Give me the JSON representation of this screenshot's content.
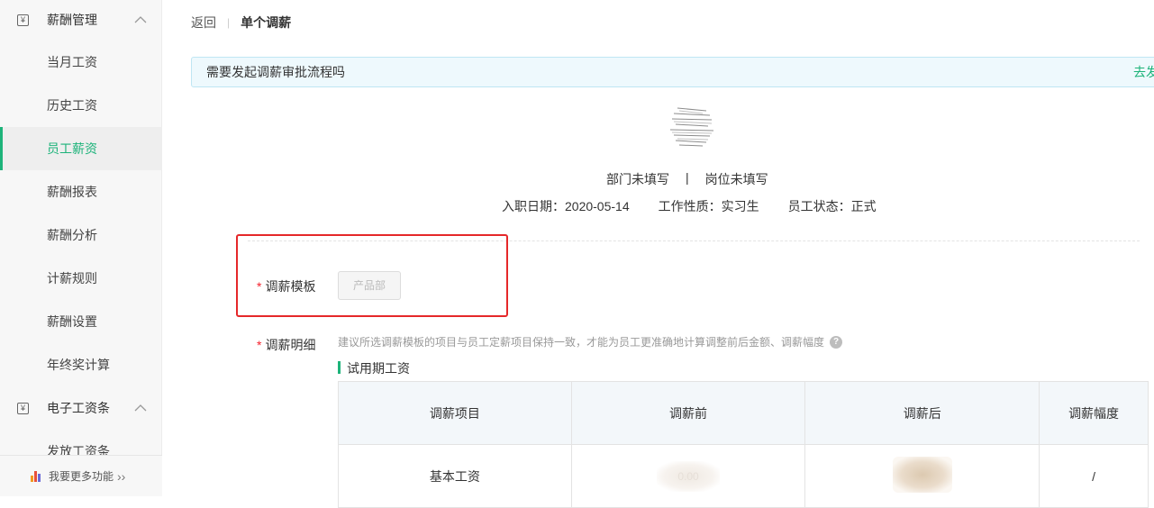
{
  "sidebar": {
    "group1": {
      "label": "薪酬管理",
      "icon": "salary-icon"
    },
    "items": [
      {
        "label": "当月工资"
      },
      {
        "label": "历史工资"
      },
      {
        "label": "员工薪资",
        "active": true
      },
      {
        "label": "薪酬报表"
      },
      {
        "label": "薪酬分析"
      },
      {
        "label": "计薪规则"
      },
      {
        "label": "薪酬设置"
      },
      {
        "label": "年终奖计算"
      }
    ],
    "group2": {
      "label": "电子工资条",
      "icon": "payslip-icon"
    },
    "partial_item": {
      "label": "发放工资条"
    },
    "more": {
      "label": "我要更多功能",
      "icon": "bar-chart-icon"
    }
  },
  "breadcrumb": {
    "back": "返回",
    "current": "单个调薪"
  },
  "notice": {
    "text": "需要发起调薪审批流程吗",
    "action": "去发"
  },
  "employee": {
    "department": "部门未填写",
    "position": "岗位未填写",
    "hire_date": "入职日期：2020-05-14",
    "work_type": "工作性质：实习生",
    "status": "员工状态：正式"
  },
  "form": {
    "template_label": "调薪模板",
    "template_value": "产品部",
    "detail_label": "调薪明细",
    "hint": "建议所选调薪模板的项目与员工定薪项目保持一致，才能为员工更准确地计算调整前后金额、调薪幅度",
    "section_title": "试用期工资"
  },
  "table": {
    "headers": [
      "调薪项目",
      "调薪前",
      "调薪后",
      "调薪幅度"
    ],
    "rows": [
      {
        "item": "基本工资",
        "before": "0.00",
        "after": "",
        "change": "/"
      }
    ]
  },
  "colors": {
    "accent": "#1db37a",
    "highlight_box": "#e5282a",
    "notice_bg": "#eef9fd"
  }
}
